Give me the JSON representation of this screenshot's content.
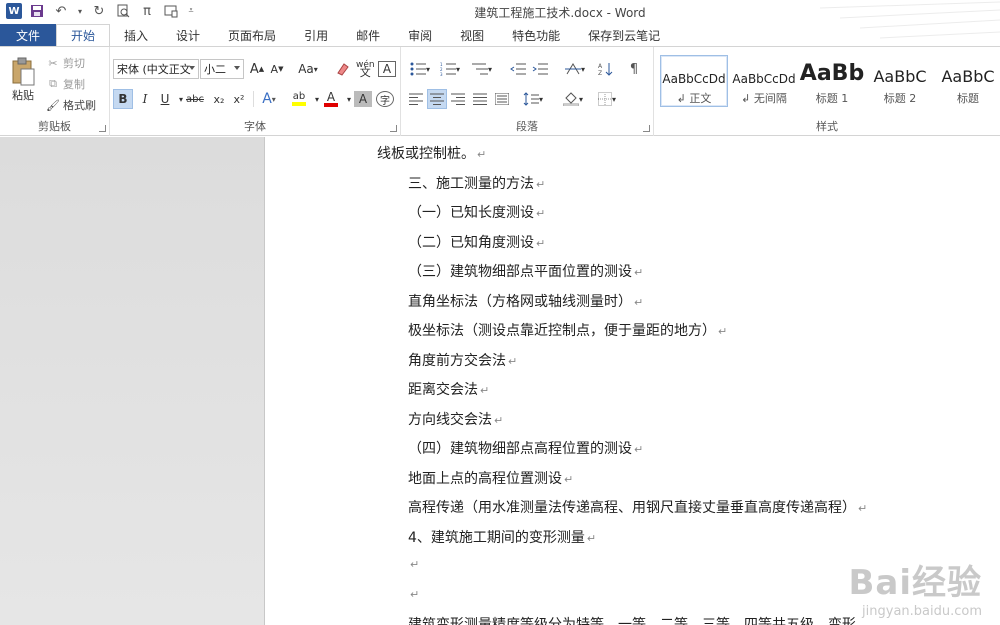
{
  "app": {
    "title": "建筑工程施工技术.docx - Word"
  },
  "quick_access": {
    "icons": [
      "word-logo",
      "save-icon",
      "undo-icon",
      "redo-icon",
      "print-preview-icon",
      "equation-icon",
      "touch-mode-icon",
      "customize-icon"
    ],
    "word_logo_text": "W",
    "pi_symbol": "π"
  },
  "tabs": [
    {
      "label": "文件"
    },
    {
      "label": "开始"
    },
    {
      "label": "插入"
    },
    {
      "label": "设计"
    },
    {
      "label": "页面布局"
    },
    {
      "label": "引用"
    },
    {
      "label": "邮件"
    },
    {
      "label": "审阅"
    },
    {
      "label": "视图"
    },
    {
      "label": "特色功能"
    },
    {
      "label": "保存到云笔记"
    }
  ],
  "ribbon": {
    "clipboard": {
      "label": "剪贴板",
      "paste": "粘贴",
      "cut": "剪切",
      "copy": "复制",
      "format_painter": "格式刷"
    },
    "font": {
      "label": "字体",
      "font_name": "宋体 (中文正文",
      "font_size": "小二",
      "grow": "A",
      "shrink": "A",
      "change_case": "Aa",
      "phonetic": "wén",
      "border_char": "A",
      "bold": "B",
      "italic": "I",
      "underline": "U",
      "strike": "abc",
      "subscript": "x₂",
      "superscript": "x²",
      "text_effect": "A",
      "highlight": "ab",
      "font_color": "A",
      "char_shading": "A",
      "enclose": "字"
    },
    "paragraph": {
      "label": "段落"
    },
    "styles": {
      "label": "样式",
      "items": [
        {
          "preview": "AaBbCcDd",
          "name": "正文"
        },
        {
          "preview": "AaBbCcDd",
          "name": "无间隔"
        },
        {
          "preview": "AaBb",
          "name": "标题 1"
        },
        {
          "preview": "AaBbC",
          "name": "标题 2"
        },
        {
          "preview": "AaBbC",
          "name": "标题"
        }
      ]
    }
  },
  "document": {
    "lines": [
      "线板或控制桩。",
      "三、施工测量的方法",
      "（一）已知长度测设",
      "（二）已知角度测设",
      "（三）建筑物细部点平面位置的测设",
      "直角坐标法（方格网或轴线测量时）",
      "极坐标法（测设点靠近控制点，便于量距的地方）",
      "角度前方交会法",
      "距离交会法",
      "方向线交会法",
      "（四）建筑物细部点高程位置的测设",
      "地面上点的高程位置测设",
      "高程传递（用水准测量法传递高程、用钢尺直接丈量垂直高度传递高程）",
      "4、建筑施工期间的变形测量",
      "",
      "",
      "建筑变形测量精度等级分为特等、一等、二等、三等、四等共五级，变形"
    ],
    "paragraph_mark": "↵"
  },
  "watermark": {
    "brand": "Bai经验",
    "url": "jingyan.baidu.com"
  }
}
